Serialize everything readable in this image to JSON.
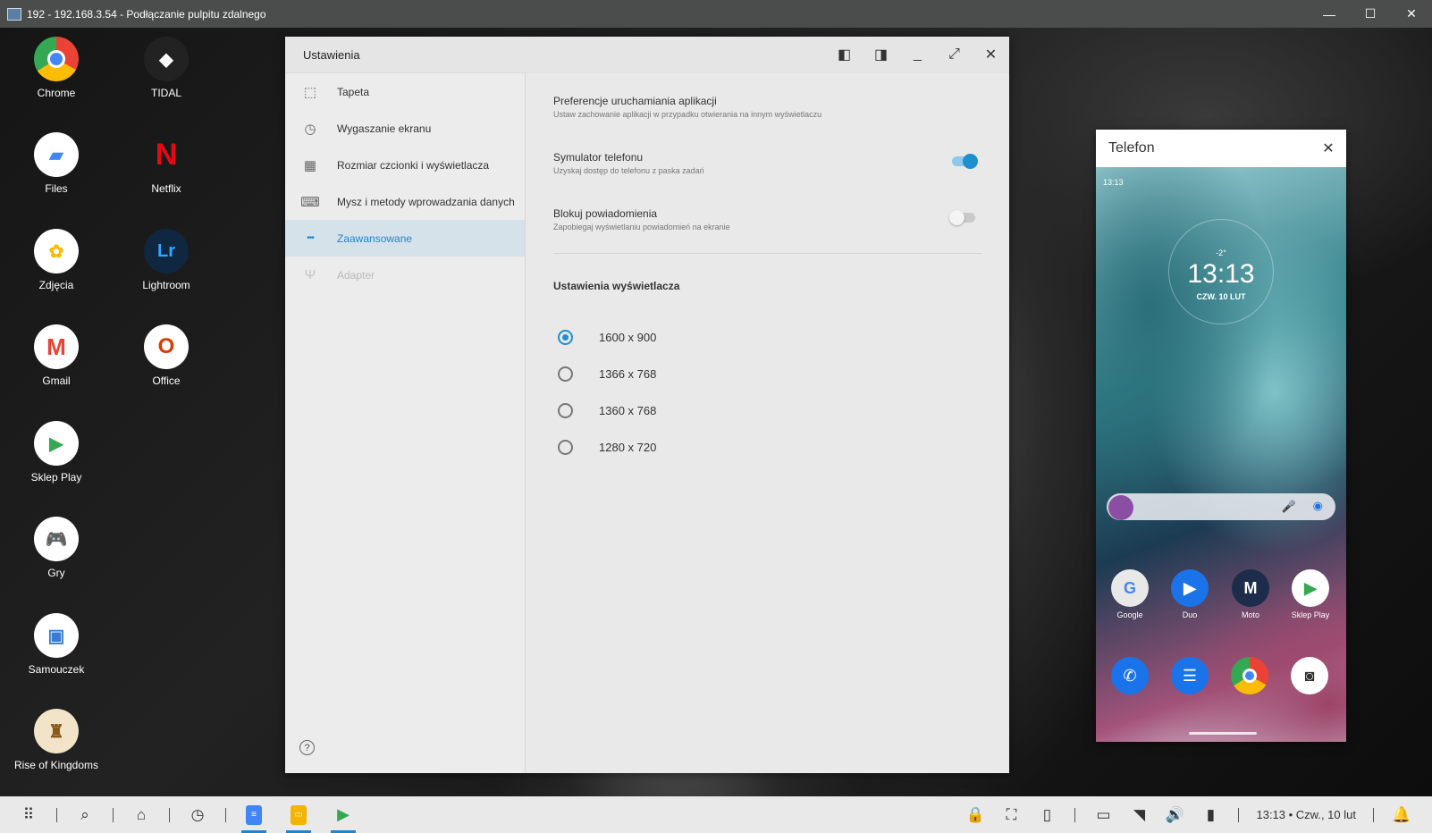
{
  "rdp": {
    "title": "192 - 192.168.3.54 - Podłączanie pulpitu zdalnego",
    "icon": "remote-desktop-icon"
  },
  "desktop": {
    "apps": [
      {
        "label": "Chrome",
        "glyph": "●"
      },
      {
        "label": "TIDAL",
        "glyph": "◆"
      },
      {
        "label": "Files",
        "glyph": "▰"
      },
      {
        "label": "Netflix",
        "glyph": "N"
      },
      {
        "label": "Zdjęcia",
        "glyph": "✿"
      },
      {
        "label": "Lightroom",
        "glyph": "Lr"
      },
      {
        "label": "Gmail",
        "glyph": "M"
      },
      {
        "label": "Office",
        "glyph": "O"
      },
      {
        "label": "Sklep Play",
        "glyph": "▶"
      },
      {
        "label": "Gry",
        "glyph": "🎮"
      },
      {
        "label": "Samouczek",
        "glyph": "▣"
      },
      {
        "label": "Rise of Kingdoms",
        "glyph": "♜"
      }
    ]
  },
  "settings": {
    "title": "Ustawienia",
    "sidebar": [
      {
        "label": "Tapeta",
        "icon": "wallpaper-icon",
        "glyph": "⬚"
      },
      {
        "label": "Wygaszanie ekranu",
        "icon": "screen-saver-icon",
        "glyph": "◷"
      },
      {
        "label": "Rozmiar czcionki i wyświetlacza",
        "icon": "grid-icon",
        "glyph": "▦"
      },
      {
        "label": "Mysz i metody wprowadzania danych",
        "icon": "keyboard-icon",
        "glyph": "⌨"
      },
      {
        "label": "Zaawansowane",
        "icon": "more-dots-icon",
        "glyph": "•••"
      },
      {
        "label": "Adapter",
        "icon": "usb-icon",
        "glyph": "Ψ"
      }
    ],
    "active_index": 4,
    "prefs": [
      {
        "title": "Preferencje uruchamiania aplikacji",
        "subtitle": "Ustaw zachowanie aplikacji w przypadku otwierania na innym wyświetlaczu"
      },
      {
        "title": "Symulator telefonu",
        "subtitle": "Uzyskaj dostęp do telefonu z paska zadań",
        "toggle": true
      },
      {
        "title": "Blokuj powiadomienia",
        "subtitle": "Zapobiegaj wyświetlaniu powiadomień na ekranie",
        "toggle": false
      }
    ],
    "display_section": "Ustawienia wyświetlacza",
    "resolutions": [
      "1600 x 900",
      "1366 x 768",
      "1360 x 768",
      "1280 x 720"
    ],
    "selected_resolution": 0
  },
  "phone": {
    "title": "Telefon",
    "status_time": "13:13",
    "temp": "-2°",
    "clock": "13:13",
    "date": "CZW. 10 LUT",
    "apps": [
      {
        "label": "Google"
      },
      {
        "label": "Duo"
      },
      {
        "label": "Moto"
      },
      {
        "label": "Sklep Play"
      }
    ]
  },
  "taskbar": {
    "clock": "13:13 • Czw., 10 lut"
  },
  "colors": {
    "accent": "#1f85c9",
    "toggle_on": "#1f8fd0",
    "sidebar_active_bg": "#d6e2ea"
  }
}
